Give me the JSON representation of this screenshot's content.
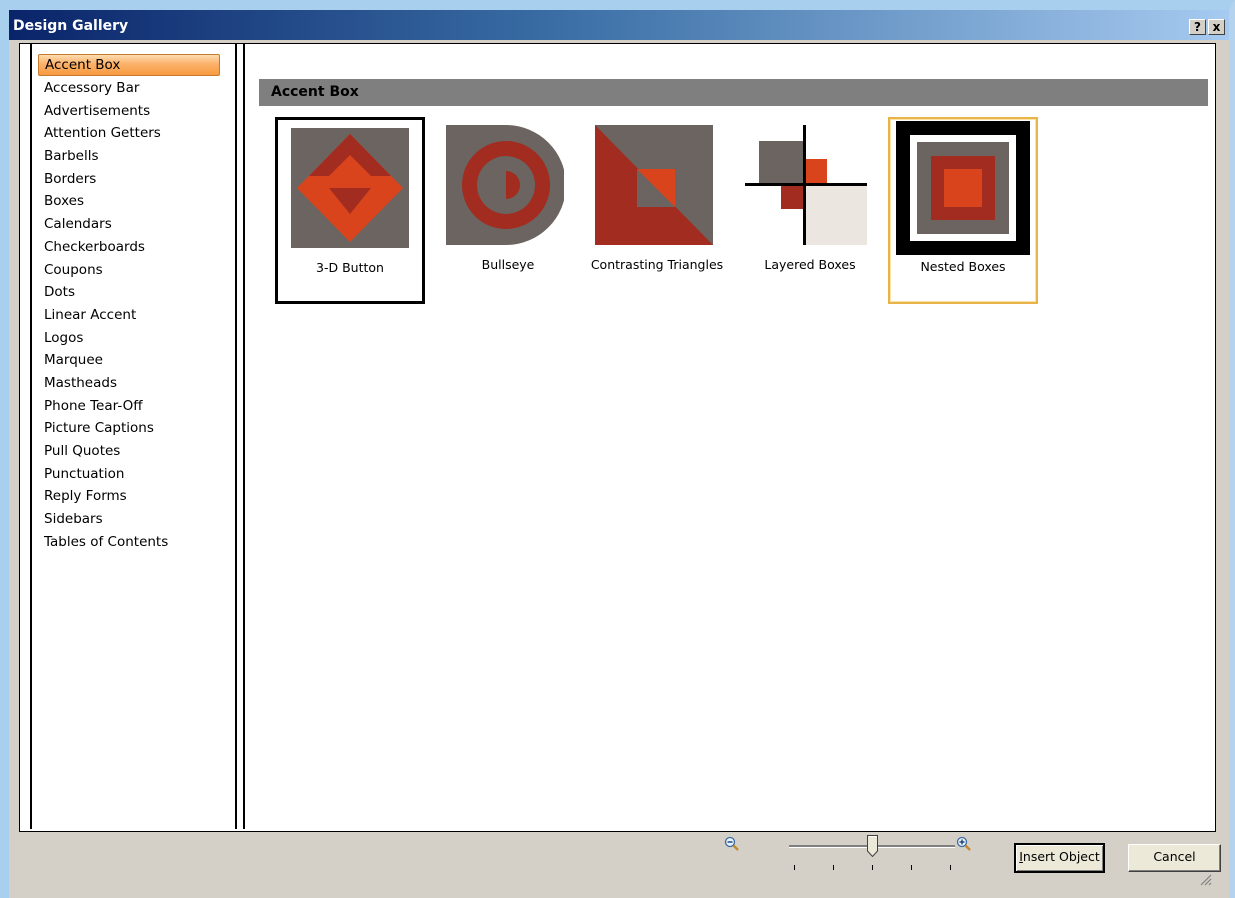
{
  "window": {
    "title": "Design Gallery",
    "help_btn": "?",
    "close_btn": "x"
  },
  "categories": [
    "Accent Box",
    "Accessory Bar",
    "Advertisements",
    "Attention Getters",
    "Barbells",
    "Borders",
    "Boxes",
    "Calendars",
    "Checkerboards",
    "Coupons",
    "Dots",
    "Linear Accent",
    "Logos",
    "Marquee",
    "Mastheads",
    "Phone Tear-Off",
    "Picture Captions",
    "Pull Quotes",
    "Punctuation",
    "Reply Forms",
    "Sidebars",
    "Tables of Contents"
  ],
  "selected_category_index": 0,
  "section": {
    "title": "Accent Box"
  },
  "designs": [
    {
      "label": "3-D Button",
      "icon": "three-d-button-icon",
      "state": "focused"
    },
    {
      "label": "Bullseye",
      "icon": "bullseye-icon",
      "state": "normal"
    },
    {
      "label": "Contrasting Triangles",
      "icon": "contrasting-triangles-icon",
      "state": "normal"
    },
    {
      "label": "Layered Boxes",
      "icon": "layered-boxes-icon",
      "state": "normal"
    },
    {
      "label": "Nested Boxes",
      "icon": "nested-boxes-icon",
      "state": "hovered"
    }
  ],
  "zoom": {
    "level_fraction": 0.5,
    "tick_count": 5
  },
  "buttons": {
    "insert": "Insert Object",
    "insert_mnemonic": "I",
    "cancel": "Cancel"
  },
  "colors": {
    "accent_orange": "#d9441c",
    "accent_red": "#a12c1f",
    "accent_gray": "#6b6460",
    "accent_cream": "#ebe6df",
    "selection": "#f79a40"
  }
}
